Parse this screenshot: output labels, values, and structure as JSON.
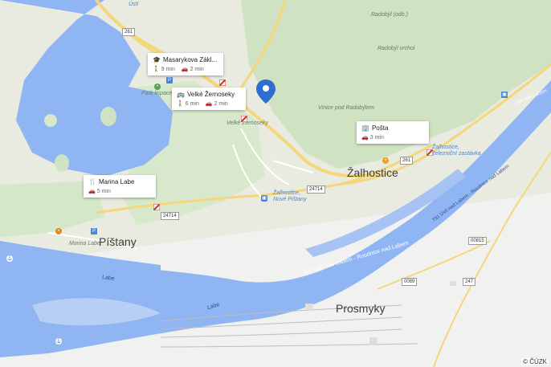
{
  "map": {
    "towns": [
      {
        "name": "Žalhostice"
      },
      {
        "name": "Píštany"
      },
      {
        "name": "Prosmyky"
      }
    ],
    "places": {
      "radobyl_odb": "Radobýl (odb.)",
      "radobyl_vrchol": "Radobýl vrchol",
      "vinice": "Vinice pod Radobýlem",
      "velke_zernoseky": "Velké Žernoseky",
      "zalhostice_nove_pistany": "Žalhostice,\nNové Píštany",
      "zalhostice_zel_zastavka": "Žalhostice,\nželezniční zastávka",
      "marina_labe": "Marina Labe",
      "park_lispacek": "Park lispacek",
      "usti": "Ústí"
    },
    "rivers": {
      "labe_1": "Labe",
      "labe_2": "Labe",
      "route_t91_upper": "T91 Ústí nad Labem - Roudnice nad Labem",
      "route_t91_lower": "T91 Ústí nad Labem - Roudnice nad Labem",
      "route_na_labem": "Ústí nad Labem"
    },
    "road_shields": {
      "r261a": "261",
      "r261b": "261",
      "r24714a": "24714",
      "r24714b": "24714",
      "r00815": "00815",
      "r0089": "0089",
      "r247": "247"
    },
    "cards": {
      "masarykova": {
        "title": "Masarykova Zákl...",
        "walk": "9 min",
        "drive": "2 min"
      },
      "velke_zernoseky": {
        "title": "Velké Žernoseky",
        "walk": "6 min",
        "drive": "2 min"
      },
      "posta": {
        "title": "Pošta",
        "drive": "3 min"
      },
      "marina_labe": {
        "title": "Marina Labe",
        "drive": "5 min"
      }
    },
    "copyright": "© ČÚZK",
    "colors": {
      "water": "#8fb5f2",
      "land": "#e8eadf",
      "forest": "#cfe3c2",
      "road_main": "#f6d67a",
      "urban": "#f2f2f2",
      "pin": "#2e6ed0"
    }
  }
}
